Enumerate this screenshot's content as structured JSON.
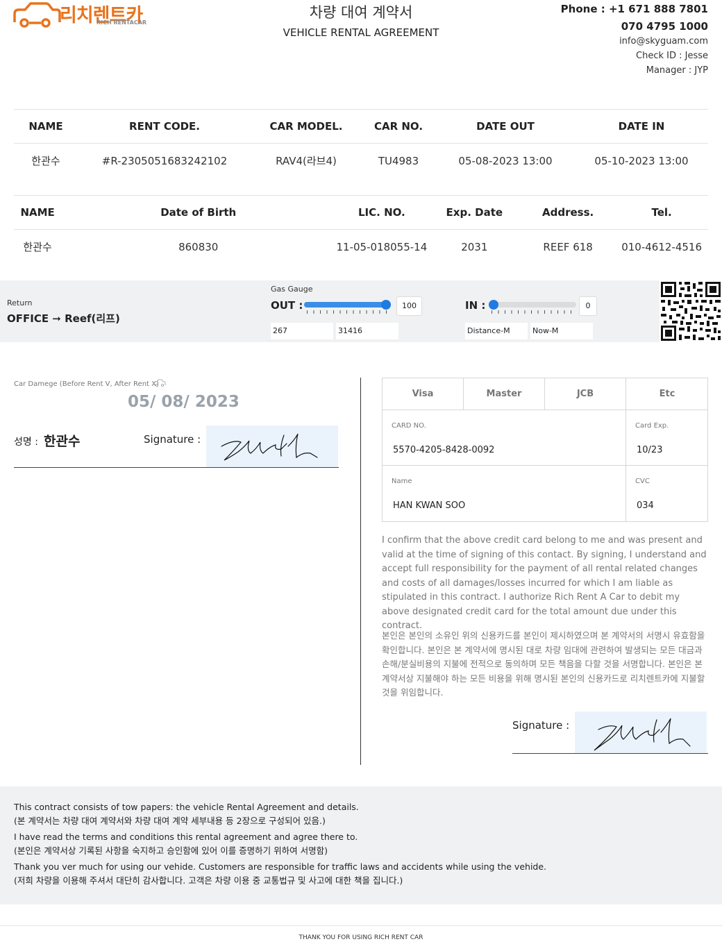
{
  "header": {
    "logo_text": "리치렌트카",
    "logo_sub": "RICH RENTACAR",
    "title_ko": "차량 대여 계약서",
    "title_en": "VEHICLE RENTAL AGREEMENT",
    "phone": "Phone : +1 671 888 7801",
    "phone2": "070 4795 1000",
    "email": "info@skyguam.com",
    "check_id": "Check ID : Jesse",
    "manager": "Manager : JYP"
  },
  "rental": {
    "headers": [
      "NAME",
      "RENT CODE.",
      "CAR MODEL.",
      "CAR NO.",
      "DATE OUT",
      "DATE IN"
    ],
    "row": [
      "한관수",
      "#R-2305051683242102",
      "RAV4(라브4)",
      "TU4983",
      "05-08-2023 13:00",
      "05-10-2023 13:00"
    ]
  },
  "driver": {
    "headers": [
      "NAME",
      "Date of Birth",
      "LIC. NO.",
      "Exp. Date",
      "Address.",
      "Tel."
    ],
    "row": [
      "한관수",
      "860830",
      "11-05-018055-14",
      "2031",
      "REEF 618",
      "010-4612-4516"
    ]
  },
  "return": {
    "label": "Return",
    "value": "OFFICE ➞ Reef(리프)"
  },
  "gauge": {
    "label": "Gas Gauge",
    "out_label": "OUT :",
    "out_value": "100",
    "out_level": 1.0,
    "out_distance": "267",
    "out_now": "31416",
    "in_label": "IN :",
    "in_value": "0",
    "in_level": 0.0,
    "in_distance_placeholder": "Distance-M",
    "in_now_placeholder": "Now-M"
  },
  "damage": {
    "label": "Car Damege (Before Rent V, After Rent X)",
    "date": "05/ 08/ 2023",
    "name_label": "성명 :",
    "name_value": "한관수",
    "signature_label": "Signature :"
  },
  "card": {
    "types": [
      "Visa",
      "Master",
      "JCB",
      "Etc"
    ],
    "card_no_label": "CARD NO.",
    "card_no": "5570-4205-8428-0092",
    "exp_label": "Card Exp.",
    "exp": "10/23",
    "name_label": "Name",
    "name": "HAN KWAN SOO",
    "cvc_label": "CVC",
    "cvc": "034"
  },
  "terms": {
    "en": "I confirm that the above credit card belong to me and was present and valid at the time of signing of this contact. By signing, I understand and accept full responsibility for the payment of all rental related changes and costs of all damages/losses incurred for which I am liable as stipulated in this contract. I authorize Rich Rent A Car to debit my above designated credit card for the total amount due under this contract.",
    "ko": "본인은 본인의 소유인 위의 신용카드를 본인이 제시하였으며 본 계약서의 서명시 유효함을 확인합니다. 본인은 본 계약서에 명시된 대로 차량 임대에 관련하여 발생되는 모든 대금과 손해/분실비용의 지불에 전적으로 동의하며 모든 책음을 다할 것을 서명합니다. 본인은 본 계약서상 지불해야 하는 모든 비용을 위해 명시된 본인의 신용카드로 리치렌트카에 지불할 것을 위임합니다.",
    "signature_label": "Signature :"
  },
  "notes": [
    "This contract consists of tow papers: the vehicle Rental Agreement and details.",
    "(본 계약서는 차량 대여 계약서와 차량 대여 계약 세부내용 등 2장으로 구성되어 있음.)",
    "I have read the terms and conditions this rental agreement and agree there to.",
    "(본인은 계약서상 기록된 사항을 숙지하고 승인함에 있어 이를 증명하기 위하여 서명함)",
    "Thank you ver much for using our vehide. Customers are responsible for traffic laws and accidents while using the vehide.",
    "(저희 차량을 이용해 주셔서 대단히 감사합니다. 고객은 차량 이용 중 교통법규 및 사고에 대한 책을 집니다.)"
  ],
  "footer": "THANK YOU FOR USING RICH RENT CAR",
  "colors": {
    "brand": "#e8731e",
    "slider": "#1e7be3",
    "panel": "#f0f1f2",
    "signature_bg": "#eaf3fc"
  }
}
